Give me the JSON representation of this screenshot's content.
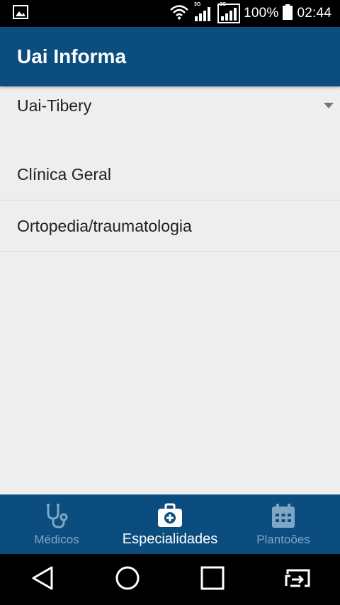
{
  "status_bar": {
    "battery_pct": "100%",
    "time": "02:44",
    "signal1_label": "3G",
    "signal2_label": "2G"
  },
  "app_bar": {
    "title": "Uai Informa"
  },
  "spinner": {
    "selected": "Uai-Tibery"
  },
  "specialties": [
    "Clínica Geral",
    "Ortopedia/traumatologia"
  ],
  "bottom_nav": {
    "items": [
      {
        "label": "Médicos",
        "icon": "stethoscope-icon"
      },
      {
        "label": "Especialidades",
        "icon": "medical-kit-icon"
      },
      {
        "label": "Plantoões",
        "icon": "calendar-icon"
      }
    ],
    "active_index": 1
  },
  "colors": {
    "primary": "#0b4d7f",
    "inactive_nav": "#7fa6c4",
    "background": "#eeeeee"
  }
}
